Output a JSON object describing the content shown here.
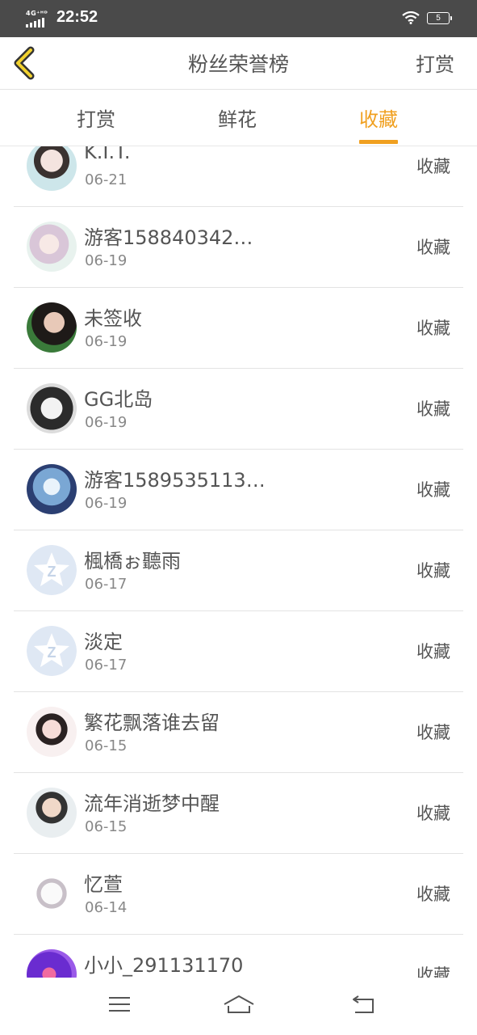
{
  "status_bar": {
    "network": "4G⁺ᴴᴰ",
    "time": "22:52",
    "battery": "5"
  },
  "header": {
    "title": "粉丝荣誉榜",
    "right_link": "打赏",
    "back_icon": "chevron-left-icon"
  },
  "tabs": [
    {
      "label": "打赏",
      "active": false
    },
    {
      "label": "鲜花",
      "active": false
    },
    {
      "label": "收藏",
      "active": true
    }
  ],
  "colors": {
    "accent": "#f0a020",
    "status_bar": "#4a4a4a",
    "text": "#555555",
    "subtext": "#888888"
  },
  "list": [
    {
      "name": "K.I.T.",
      "date": "06-21",
      "action": "收藏",
      "avatar": "photo"
    },
    {
      "name": "游客158840342…",
      "date": "06-19",
      "action": "收藏",
      "avatar": "photo"
    },
    {
      "name": "未签收",
      "date": "06-19",
      "action": "收藏",
      "avatar": "photo"
    },
    {
      "name": "GG北岛",
      "date": "06-19",
      "action": "收藏",
      "avatar": "photo"
    },
    {
      "name": "游客1589535113…",
      "date": "06-19",
      "action": "收藏",
      "avatar": "photo"
    },
    {
      "name": "楓橋ぉ聽雨",
      "date": "06-17",
      "action": "收藏",
      "avatar": "default-star-icon"
    },
    {
      "name": "淡定",
      "date": "06-17",
      "action": "收藏",
      "avatar": "default-star-icon"
    },
    {
      "name": "繁花飘落谁去留",
      "date": "06-15",
      "action": "收藏",
      "avatar": "photo"
    },
    {
      "name": "流年消逝梦中醒",
      "date": "06-15",
      "action": "收藏",
      "avatar": "photo"
    },
    {
      "name": "忆萱",
      "date": "06-14",
      "action": "收藏",
      "avatar": "photo"
    },
    {
      "name": "小小_291131170",
      "date": "",
      "action": "收藏",
      "avatar": "photo"
    }
  ],
  "nav_bar": [
    "menu-icon",
    "home-icon",
    "back-icon"
  ]
}
